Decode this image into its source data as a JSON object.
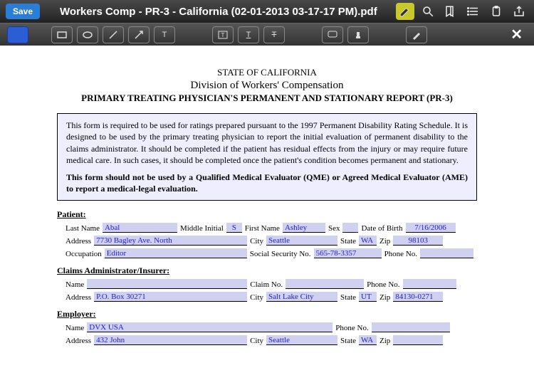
{
  "header": {
    "save_label": "Save",
    "title": "Workers Comp - PR-3 - California (02-01-2013 03-17-17 PM).pdf"
  },
  "document": {
    "state": "STATE OF CALIFORNIA",
    "division": "Division of Workers' Compensation",
    "report_title": "PRIMARY TREATING PHYSICIAN'S PERMANENT AND STATIONARY REPORT (PR-3)",
    "instructions_p1": "This form is required to be used for ratings prepared pursuant to the 1997 Permanent Disability Rating Schedule. It is designed to be used by the primary treating physician to report the initial evaluation of permanent disability to the claims administrator.  It should be completed if the patient has residual effects from the injury or may require future medical care.  In such cases, it should be completed once the patient's condition becomes permanent and stationary.",
    "instructions_p2": "This form should not be used by a Qualified Medical Evaluator (QME) or Agreed Medical Evaluator (AME) to report a medical-legal evaluation.",
    "sections": {
      "patient": "Patient:",
      "admin": "Claims Administrator/Insurer:",
      "employer": "Employer:"
    },
    "labels": {
      "last_name": "Last Name",
      "middle_initial": "Middle Initial",
      "first_name": "First Name",
      "sex": "Sex",
      "dob": "Date of Birth",
      "address": "Address",
      "city": "City",
      "state": "State",
      "zip": "Zip",
      "occupation": "Occupation",
      "ssn": "Social Security No.",
      "phone": "Phone No.",
      "name": "Name",
      "claim_no": "Claim No."
    },
    "patient": {
      "last_name": "Abal",
      "mi": "S",
      "first_name": "Ashley",
      "sex": "",
      "dob": "7/16/2006",
      "address": "7730 Bagley Ave. North",
      "city": "Seattle",
      "state": "WA",
      "zip": "98103",
      "occupation": "Editor",
      "ssn": "565-78-3357",
      "phone": ""
    },
    "admin": {
      "name": "",
      "claim_no": "",
      "phone": "",
      "address": "P.O. Box 30271",
      "city": "Salt Lake City",
      "state": "UT",
      "zip": "84130-0271"
    },
    "employer": {
      "name": "DVX USA",
      "phone": "",
      "address": "432 John",
      "city": "Seattle",
      "state": "WA",
      "zip": ""
    }
  }
}
